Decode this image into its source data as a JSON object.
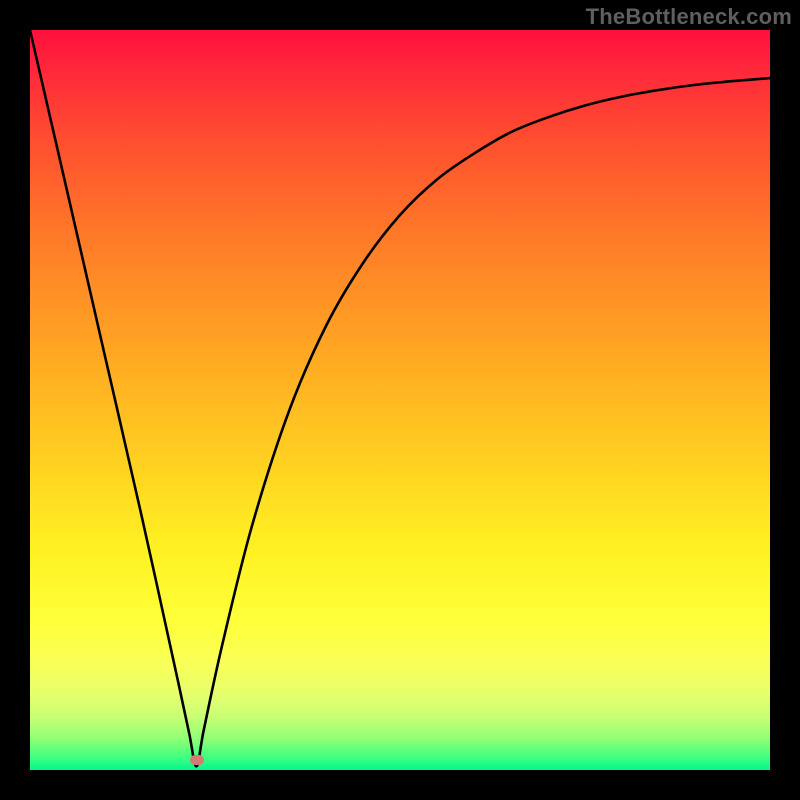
{
  "watermark": "TheBottleneck.com",
  "marker": {
    "color": "#d57b74",
    "x_frac": 0.225,
    "y_frac": 0.987
  },
  "chart_data": {
    "type": "line",
    "title": "",
    "xlabel": "",
    "ylabel": "",
    "xlim": [
      0,
      1
    ],
    "ylim": [
      0,
      1
    ],
    "series": [
      {
        "name": "curve",
        "x": [
          0.0,
          0.05,
          0.1,
          0.15,
          0.2,
          0.215,
          0.225,
          0.235,
          0.26,
          0.3,
          0.35,
          0.4,
          0.45,
          0.5,
          0.55,
          0.6,
          0.65,
          0.7,
          0.75,
          0.8,
          0.85,
          0.9,
          0.95,
          1.0
        ],
        "y": [
          1.0,
          0.783,
          0.565,
          0.347,
          0.12,
          0.05,
          0.005,
          0.055,
          0.17,
          0.33,
          0.485,
          0.6,
          0.685,
          0.75,
          0.798,
          0.833,
          0.862,
          0.882,
          0.898,
          0.91,
          0.919,
          0.926,
          0.931,
          0.935
        ]
      }
    ],
    "min_marker": {
      "x": 0.225,
      "y": 0.005
    }
  }
}
